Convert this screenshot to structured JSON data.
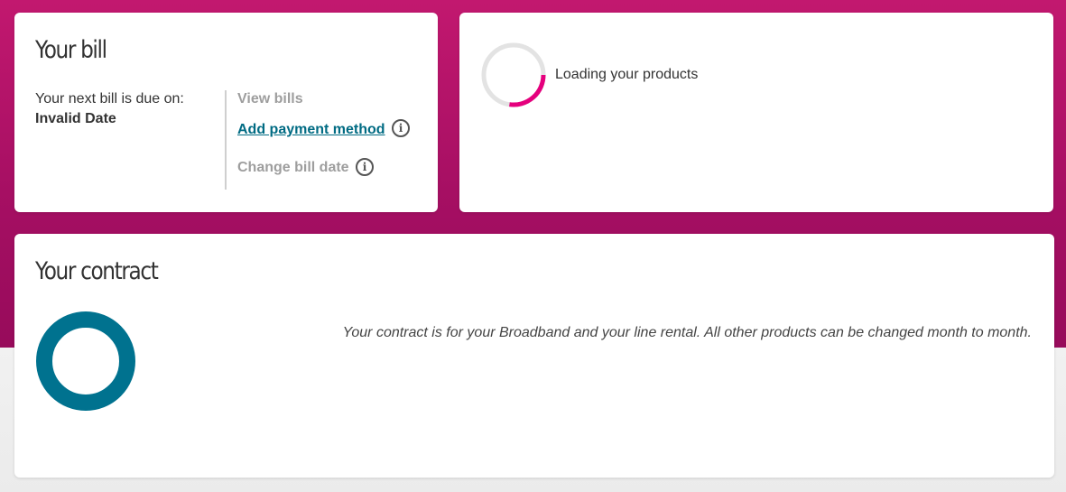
{
  "bill": {
    "title": "Your bill",
    "due_label": "Your next bill is due on:",
    "due_value": "Invalid Date",
    "view_bills": "View bills",
    "add_payment": "Add payment method",
    "change_date": "Change bill date",
    "info_glyph": "i"
  },
  "products": {
    "loading_text": "Loading your products"
  },
  "contract": {
    "title": "Your contract",
    "description": "Your contract is for your Broadband and your line rental. All other products can be changed month to month."
  },
  "colors": {
    "brand_magenta": "#c2186f",
    "link_teal": "#006b83",
    "spinner_accent": "#e5007d",
    "donut": "#00728f"
  }
}
